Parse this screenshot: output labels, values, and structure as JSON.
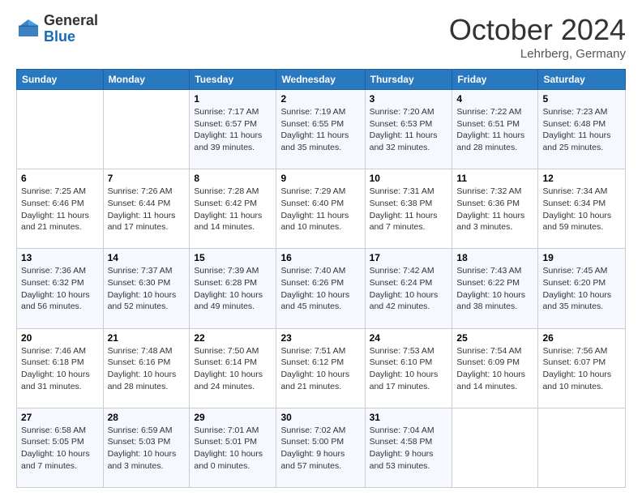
{
  "logo": {
    "general": "General",
    "blue": "Blue"
  },
  "header": {
    "month": "October 2024",
    "location": "Lehrberg, Germany"
  },
  "weekdays": [
    "Sunday",
    "Monday",
    "Tuesday",
    "Wednesday",
    "Thursday",
    "Friday",
    "Saturday"
  ],
  "weeks": [
    [
      null,
      null,
      {
        "day": "1",
        "sunrise": "7:17 AM",
        "sunset": "6:57 PM",
        "daylight": "11 hours and 39 minutes."
      },
      {
        "day": "2",
        "sunrise": "7:19 AM",
        "sunset": "6:55 PM",
        "daylight": "11 hours and 35 minutes."
      },
      {
        "day": "3",
        "sunrise": "7:20 AM",
        "sunset": "6:53 PM",
        "daylight": "11 hours and 32 minutes."
      },
      {
        "day": "4",
        "sunrise": "7:22 AM",
        "sunset": "6:51 PM",
        "daylight": "11 hours and 28 minutes."
      },
      {
        "day": "5",
        "sunrise": "7:23 AM",
        "sunset": "6:48 PM",
        "daylight": "11 hours and 25 minutes."
      }
    ],
    [
      {
        "day": "6",
        "sunrise": "7:25 AM",
        "sunset": "6:46 PM",
        "daylight": "11 hours and 21 minutes."
      },
      {
        "day": "7",
        "sunrise": "7:26 AM",
        "sunset": "6:44 PM",
        "daylight": "11 hours and 17 minutes."
      },
      {
        "day": "8",
        "sunrise": "7:28 AM",
        "sunset": "6:42 PM",
        "daylight": "11 hours and 14 minutes."
      },
      {
        "day": "9",
        "sunrise": "7:29 AM",
        "sunset": "6:40 PM",
        "daylight": "11 hours and 10 minutes."
      },
      {
        "day": "10",
        "sunrise": "7:31 AM",
        "sunset": "6:38 PM",
        "daylight": "11 hours and 7 minutes."
      },
      {
        "day": "11",
        "sunrise": "7:32 AM",
        "sunset": "6:36 PM",
        "daylight": "11 hours and 3 minutes."
      },
      {
        "day": "12",
        "sunrise": "7:34 AM",
        "sunset": "6:34 PM",
        "daylight": "10 hours and 59 minutes."
      }
    ],
    [
      {
        "day": "13",
        "sunrise": "7:36 AM",
        "sunset": "6:32 PM",
        "daylight": "10 hours and 56 minutes."
      },
      {
        "day": "14",
        "sunrise": "7:37 AM",
        "sunset": "6:30 PM",
        "daylight": "10 hours and 52 minutes."
      },
      {
        "day": "15",
        "sunrise": "7:39 AM",
        "sunset": "6:28 PM",
        "daylight": "10 hours and 49 minutes."
      },
      {
        "day": "16",
        "sunrise": "7:40 AM",
        "sunset": "6:26 PM",
        "daylight": "10 hours and 45 minutes."
      },
      {
        "day": "17",
        "sunrise": "7:42 AM",
        "sunset": "6:24 PM",
        "daylight": "10 hours and 42 minutes."
      },
      {
        "day": "18",
        "sunrise": "7:43 AM",
        "sunset": "6:22 PM",
        "daylight": "10 hours and 38 minutes."
      },
      {
        "day": "19",
        "sunrise": "7:45 AM",
        "sunset": "6:20 PM",
        "daylight": "10 hours and 35 minutes."
      }
    ],
    [
      {
        "day": "20",
        "sunrise": "7:46 AM",
        "sunset": "6:18 PM",
        "daylight": "10 hours and 31 minutes."
      },
      {
        "day": "21",
        "sunrise": "7:48 AM",
        "sunset": "6:16 PM",
        "daylight": "10 hours and 28 minutes."
      },
      {
        "day": "22",
        "sunrise": "7:50 AM",
        "sunset": "6:14 PM",
        "daylight": "10 hours and 24 minutes."
      },
      {
        "day": "23",
        "sunrise": "7:51 AM",
        "sunset": "6:12 PM",
        "daylight": "10 hours and 21 minutes."
      },
      {
        "day": "24",
        "sunrise": "7:53 AM",
        "sunset": "6:10 PM",
        "daylight": "10 hours and 17 minutes."
      },
      {
        "day": "25",
        "sunrise": "7:54 AM",
        "sunset": "6:09 PM",
        "daylight": "10 hours and 14 minutes."
      },
      {
        "day": "26",
        "sunrise": "7:56 AM",
        "sunset": "6:07 PM",
        "daylight": "10 hours and 10 minutes."
      }
    ],
    [
      {
        "day": "27",
        "sunrise": "6:58 AM",
        "sunset": "5:05 PM",
        "daylight": "10 hours and 7 minutes."
      },
      {
        "day": "28",
        "sunrise": "6:59 AM",
        "sunset": "5:03 PM",
        "daylight": "10 hours and 3 minutes."
      },
      {
        "day": "29",
        "sunrise": "7:01 AM",
        "sunset": "5:01 PM",
        "daylight": "10 hours and 0 minutes."
      },
      {
        "day": "30",
        "sunrise": "7:02 AM",
        "sunset": "5:00 PM",
        "daylight": "9 hours and 57 minutes."
      },
      {
        "day": "31",
        "sunrise": "7:04 AM",
        "sunset": "4:58 PM",
        "daylight": "9 hours and 53 minutes."
      },
      null,
      null
    ]
  ],
  "labels": {
    "sunrise": "Sunrise:",
    "sunset": "Sunset:",
    "daylight": "Daylight:"
  }
}
